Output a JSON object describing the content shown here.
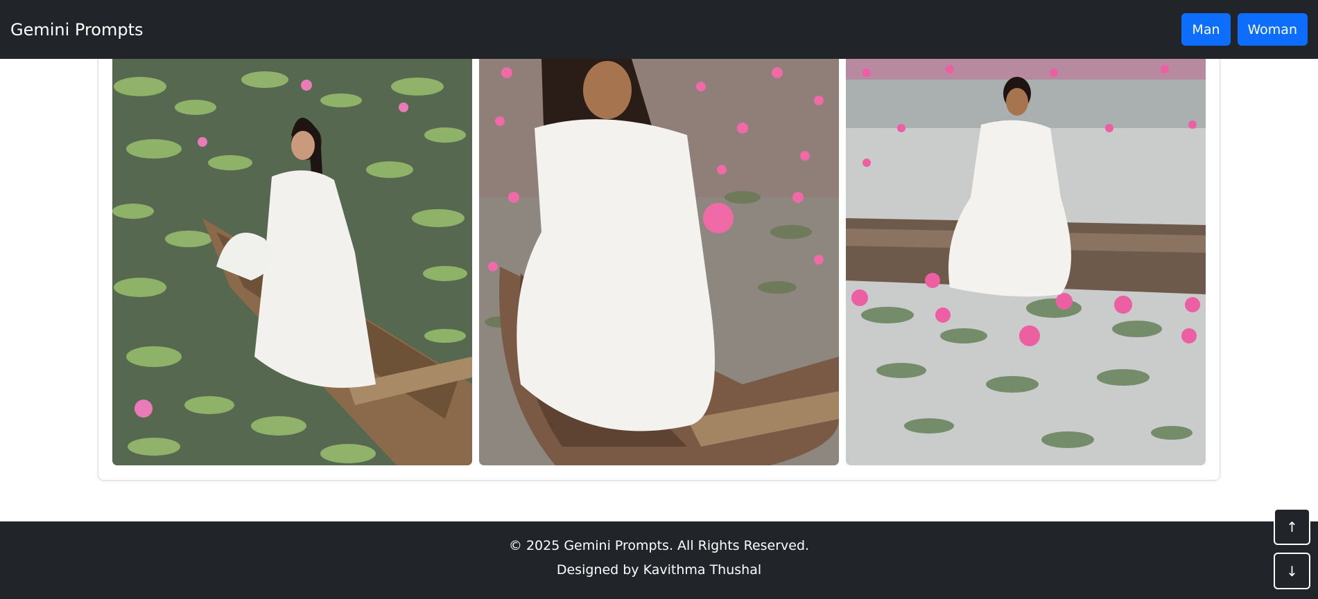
{
  "navbar": {
    "brand": "Gemini Prompts",
    "buttons": [
      "Man",
      "Woman"
    ]
  },
  "gallery": {
    "images": [
      {
        "name": "lotus-boat-photo-1",
        "palette": {
          "water": "#4d6150",
          "pad": "#8fb06a",
          "dress": "#f2f1ee",
          "boat": "#8a6a4a",
          "flower": "#e87bb8"
        }
      },
      {
        "name": "lotus-boat-photo-2",
        "palette": {
          "water": "#8d8780",
          "pad": "#6f7a5a",
          "dress": "#f4f2ef",
          "boat": "#7a5a45",
          "flower": "#ef6aa6"
        }
      },
      {
        "name": "lotus-boat-photo-3",
        "palette": {
          "water": "#c9cccb",
          "pad": "#758c6a",
          "dress": "#f3f2ef",
          "boat": "#6d5a4a",
          "flower": "#ec5fa2"
        }
      }
    ]
  },
  "footer": {
    "copyright": "© 2025 Gemini Prompts. All Rights Reserved.",
    "credit": "Designed by Kavithma Thushal"
  },
  "scroll": {
    "up_label": "↑",
    "down_label": "↓"
  }
}
